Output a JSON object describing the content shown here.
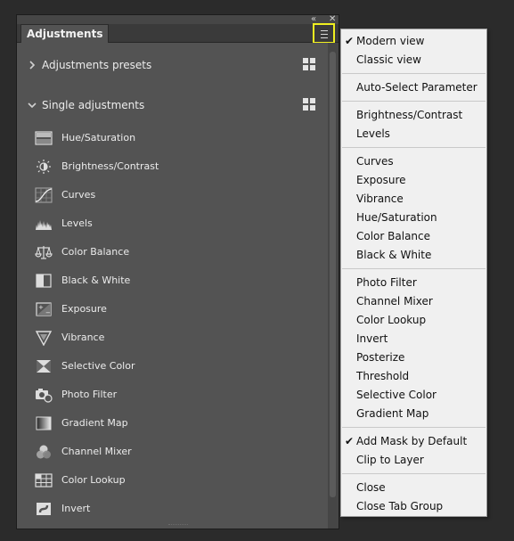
{
  "panel": {
    "tab_label": "Adjustments",
    "collapse_glyph": "«",
    "close_glyph": "✕",
    "menu_button_icon": "hamburger-menu-icon",
    "highlight_color": "#f0ef20",
    "sections": [
      {
        "label": "Adjustments presets",
        "expanded": false
      },
      {
        "label": "Single adjustments",
        "expanded": true
      }
    ],
    "items": [
      {
        "label": "Hue/Saturation",
        "icon": "hue-saturation-icon"
      },
      {
        "label": "Brightness/Contrast",
        "icon": "brightness-contrast-icon"
      },
      {
        "label": "Curves",
        "icon": "curves-icon"
      },
      {
        "label": "Levels",
        "icon": "levels-icon"
      },
      {
        "label": "Color Balance",
        "icon": "color-balance-icon"
      },
      {
        "label": "Black & White",
        "icon": "black-white-icon"
      },
      {
        "label": "Exposure",
        "icon": "exposure-icon"
      },
      {
        "label": "Vibrance",
        "icon": "vibrance-icon"
      },
      {
        "label": "Selective Color",
        "icon": "selective-color-icon"
      },
      {
        "label": "Photo Filter",
        "icon": "photo-filter-icon"
      },
      {
        "label": "Gradient Map",
        "icon": "gradient-map-icon"
      },
      {
        "label": "Channel Mixer",
        "icon": "channel-mixer-icon"
      },
      {
        "label": "Color Lookup",
        "icon": "color-lookup-icon"
      },
      {
        "label": "Invert",
        "icon": "invert-icon"
      }
    ]
  },
  "menu": {
    "check_glyph": "✔",
    "groups": [
      [
        {
          "label": "Modern view",
          "checked": true
        },
        {
          "label": "Classic view",
          "checked": false
        }
      ],
      [
        {
          "label": "Auto-Select Parameter",
          "checked": false
        }
      ],
      [
        {
          "label": "Brightness/Contrast",
          "checked": false
        },
        {
          "label": "Levels",
          "checked": false
        }
      ],
      [
        {
          "label": "Curves"
        },
        {
          "label": "Exposure"
        },
        {
          "label": "Vibrance"
        },
        {
          "label": "Hue/Saturation"
        },
        {
          "label": "Color Balance"
        },
        {
          "label": "Black & White"
        }
      ],
      [
        {
          "label": "Photo Filter"
        },
        {
          "label": "Channel Mixer"
        },
        {
          "label": "Color Lookup"
        },
        {
          "label": "Invert"
        },
        {
          "label": "Posterize"
        },
        {
          "label": "Threshold"
        },
        {
          "label": "Selective Color"
        },
        {
          "label": "Gradient Map"
        }
      ],
      [
        {
          "label": "Add Mask by Default",
          "checked": true
        },
        {
          "label": "Clip to Layer",
          "checked": false
        }
      ],
      [
        {
          "label": "Close"
        },
        {
          "label": "Close Tab Group"
        }
      ]
    ]
  }
}
